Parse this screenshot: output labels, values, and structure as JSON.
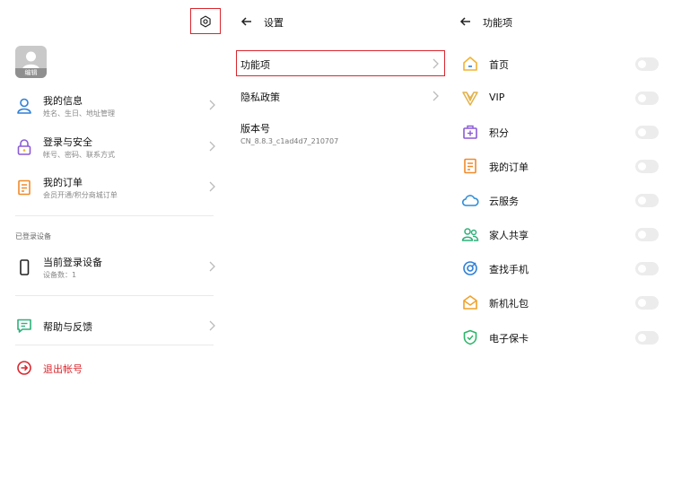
{
  "profile": {
    "edit_label": "编辑"
  },
  "account": {
    "items": [
      {
        "title": "我的信息",
        "subtitle": "姓名、生日、地址管理",
        "icon": "person-icon"
      },
      {
        "title": "登录与安全",
        "subtitle": "帐号、密码、联系方式",
        "icon": "lock-icon"
      },
      {
        "title": "我的订单",
        "subtitle": "会员开通/积分商城订单",
        "icon": "receipt-icon"
      }
    ],
    "devices_section_label": "已登录设备",
    "current_device": {
      "title": "当前登录设备",
      "subtitle": "设备数：1"
    },
    "help": {
      "title": "帮助与反馈"
    },
    "logout": {
      "title": "退出帐号"
    }
  },
  "settings": {
    "title": "设置",
    "items": [
      {
        "title": "功能项"
      },
      {
        "title": "隐私政策"
      },
      {
        "title": "版本号",
        "subtitle": "CN_8.8.3_c1ad4d7_210707"
      }
    ]
  },
  "features": {
    "title": "功能项",
    "items": [
      {
        "label": "首页",
        "icon": "home-icon",
        "color": "#f2b233"
      },
      {
        "label": "VIP",
        "icon": "vip-icon",
        "color": "#e2b24a"
      },
      {
        "label": "积分",
        "icon": "points-icon",
        "color": "#8a5bd6"
      },
      {
        "label": "我的订单",
        "icon": "order-icon",
        "color": "#f08a2a"
      },
      {
        "label": "云服务",
        "icon": "cloud-icon",
        "color": "#2c8cd9"
      },
      {
        "label": "家人共享",
        "icon": "family-icon",
        "color": "#2fb07a"
      },
      {
        "label": "查找手机",
        "icon": "find-phone-icon",
        "color": "#2f7fd6"
      },
      {
        "label": "新机礼包",
        "icon": "gift-icon",
        "color": "#f0a22a"
      },
      {
        "label": "电子保卡",
        "icon": "shield-icon",
        "color": "#2db56a"
      }
    ]
  },
  "colors": {
    "accent_red": "#d9272e",
    "toggle_off": "#ececec"
  }
}
